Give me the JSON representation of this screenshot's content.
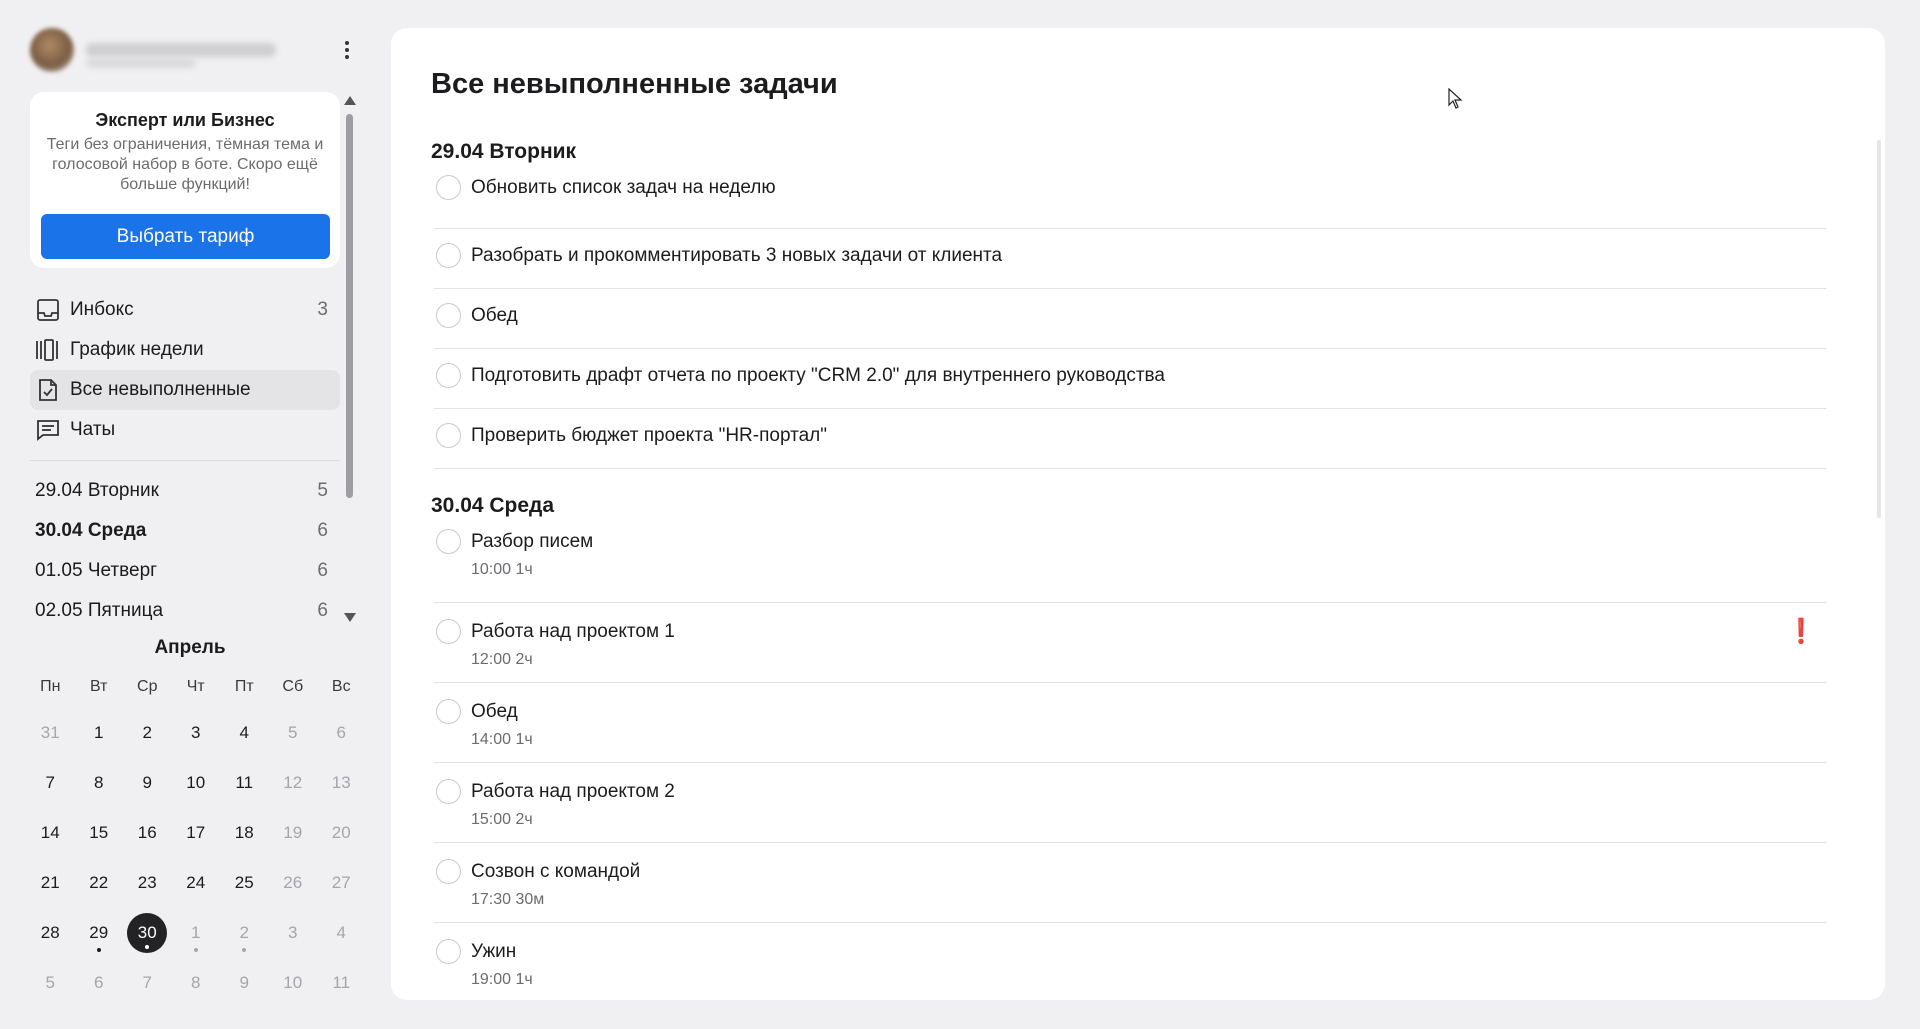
{
  "sidebar": {
    "promo": {
      "title": "Эксперт или Бизнес",
      "text": "Теги без ограничения, тёмная тема и голосовой набор в боте. Скоро ещё больше функций!",
      "button_label": "Выбрать тариф",
      "button_color": "#1a73e8"
    },
    "nav": [
      {
        "label": "Инбокс",
        "count": "3",
        "icon": "inbox-icon"
      },
      {
        "label": "График недели",
        "count": "",
        "icon": "week-schedule-icon"
      },
      {
        "label": "Все невыполненные",
        "count": "",
        "icon": "checked-document-icon"
      },
      {
        "label": "Чаты",
        "count": "",
        "icon": "chat-icon"
      }
    ],
    "days": [
      {
        "label": "29.04 Вторник",
        "count": "5"
      },
      {
        "label": "30.04 Среда",
        "count": "6"
      },
      {
        "label": "01.05 Четверг",
        "count": "6"
      },
      {
        "label": "02.05 Пятница",
        "count": "6"
      }
    ],
    "calendar": {
      "month": "Апрель",
      "weekdays": [
        "Пн",
        "Вт",
        "Ср",
        "Чт",
        "Пт",
        "Сб",
        "Вс"
      ],
      "weeks": [
        [
          "31",
          "1",
          "2",
          "3",
          "4",
          "5",
          "6"
        ],
        [
          "7",
          "8",
          "9",
          "10",
          "11",
          "12",
          "13"
        ],
        [
          "14",
          "15",
          "16",
          "17",
          "18",
          "19",
          "20"
        ],
        [
          "21",
          "22",
          "23",
          "24",
          "25",
          "26",
          "27"
        ],
        [
          "28",
          "29",
          "30",
          "1",
          "2",
          "3",
          "4"
        ],
        [
          "5",
          "6",
          "7",
          "8",
          "9",
          "10",
          "11"
        ]
      ],
      "today": "30"
    }
  },
  "main": {
    "title": "Все невыполненные задачи",
    "sections": [
      {
        "title": "29.04 Вторник",
        "tasks": [
          {
            "label": "Обновить список задач на неделю"
          },
          {
            "label": "Разобрать и прокомментировать 3 новых задачи от клиента"
          },
          {
            "label": "Обед"
          },
          {
            "label": "Подготовить драфт отчета по проекту \"CRM 2.0\" для внутреннего руководства"
          },
          {
            "label": "Проверить бюджет проекта \"HR-портал\""
          }
        ]
      },
      {
        "title": "30.04 Среда",
        "tasks": [
          {
            "label": "Разбор писем",
            "time": "10:00 1ч"
          },
          {
            "label": "Работа над проектом 1",
            "time": "12:00 2ч",
            "priority": "❗"
          },
          {
            "label": "Обед",
            "time": "14:00 1ч"
          },
          {
            "label": "Работа над проектом 2",
            "time": "15:00 2ч"
          },
          {
            "label": "Созвон с командой",
            "time": "17:30 30м"
          },
          {
            "label": "Ужин",
            "time": "19:00 1ч"
          }
        ]
      }
    ]
  }
}
